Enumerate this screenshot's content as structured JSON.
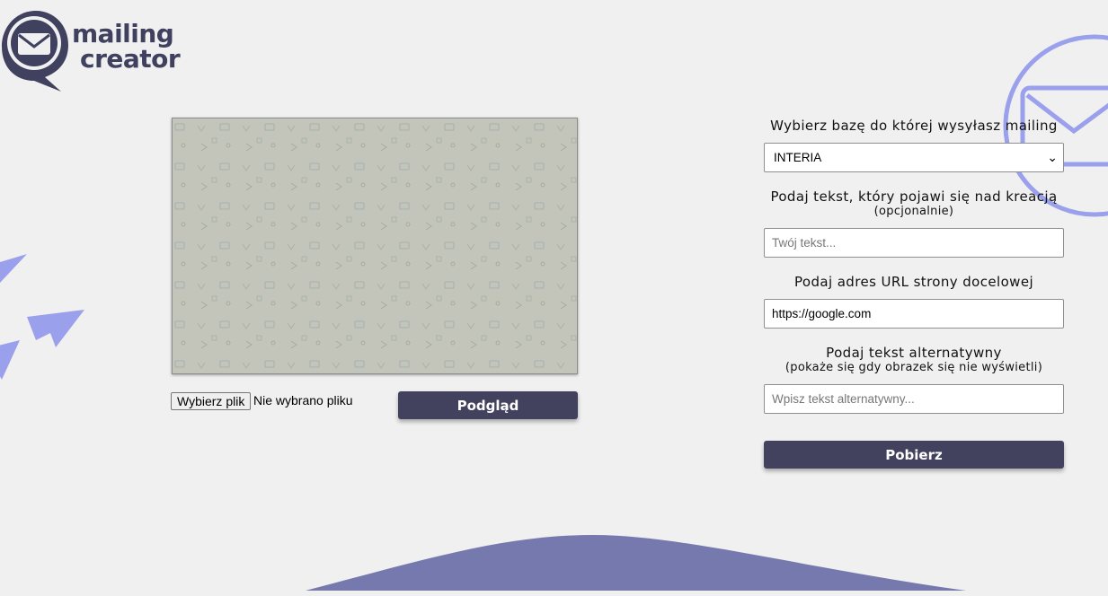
{
  "logo": {
    "line1": "mailing",
    "line2": "creator"
  },
  "preview": {
    "file_button_label": "Wybierz plik",
    "file_status": "Nie wybrano pliku",
    "preview_button_label": "Podgląd"
  },
  "form": {
    "base_label": "Wybierz bazę do której wysyłasz mailing",
    "base_selected": "INTERIA",
    "top_text_label": "Podaj tekst, który pojawi się nad kreacją",
    "top_text_sub": "(opcjonalnie)",
    "top_text_placeholder": "Twój tekst...",
    "url_label": "Podaj adres URL strony docelowej",
    "url_value": "https://google.com",
    "alt_label": "Podaj tekst alternatywny",
    "alt_sub": "(pokaże się gdy obrazek się nie wyświetli)",
    "alt_placeholder": "Wpisz tekst alternatywny...",
    "download_button_label": "Pobierz"
  },
  "colors": {
    "background": "#f0f0f0",
    "brand_dark": "#42425e",
    "accent_lavender": "#9aa0ec",
    "wave": "#7679ad",
    "preview_fill": "#c3c5bb"
  },
  "icons": [
    "mail-bubble-logo-icon",
    "envelope-icon",
    "paper-plane-icon",
    "chevron-down-icon"
  ]
}
